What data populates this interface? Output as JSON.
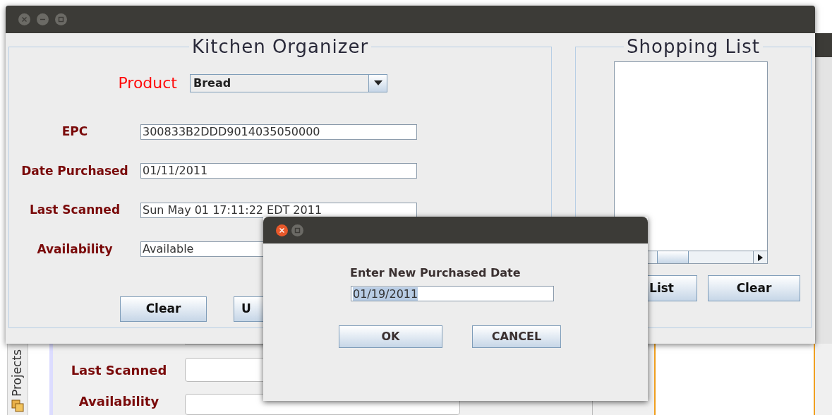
{
  "main_window": {
    "organizer": {
      "title": "Kitchen Organizer",
      "product": {
        "label": "Product",
        "value": "Bread"
      },
      "fields": [
        {
          "label": "EPC",
          "value": "300833B2DDD9014035050000"
        },
        {
          "label": "Date Purchased",
          "value": "01/11/2011"
        },
        {
          "label": "Last Scanned",
          "value": "Sun May 01 17:11:22 EDT 2011"
        },
        {
          "label": "Availability",
          "value": "Available"
        }
      ],
      "buttons": [
        "Clear",
        "U"
      ]
    },
    "shopping_list": {
      "title": "Shopping List",
      "buttons": [
        "List",
        "Clear"
      ]
    }
  },
  "dialog": {
    "prompt": "Enter New Purchased Date",
    "value": "01/19/2011",
    "text_selected": true,
    "buttons": [
      "OK",
      "CANCEL"
    ]
  },
  "background_ide": {
    "projects_tab": "Projects",
    "fields": [
      {
        "label": "Last Scanned"
      },
      {
        "label": "Availability"
      }
    ]
  }
}
